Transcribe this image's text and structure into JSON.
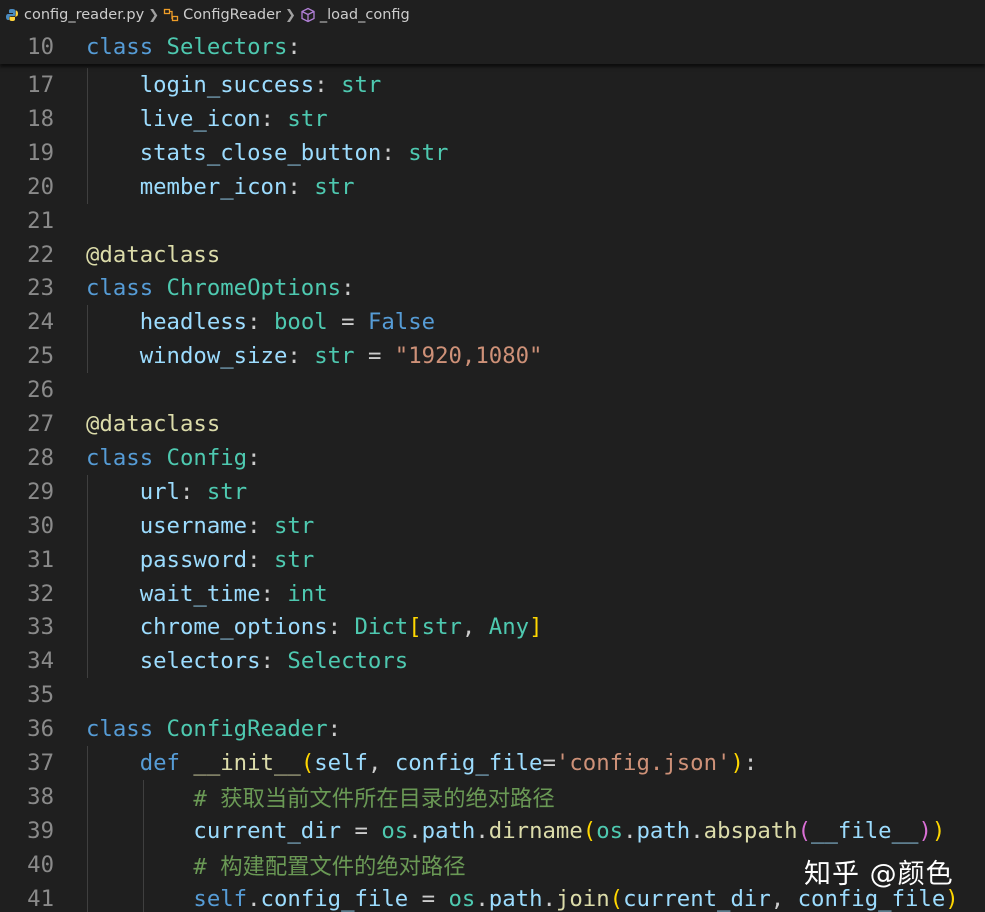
{
  "breadcrumb": {
    "file": "config_reader.py",
    "class": "ConfigReader",
    "method": "_load_config"
  },
  "editor": {
    "lines": [
      {
        "n": "10",
        "t": [
          [
            "kw",
            "class "
          ],
          [
            "cls",
            "Selectors"
          ],
          [
            "plain",
            ":"
          ]
        ]
      },
      {
        "n": "17",
        "t": [
          [
            "plain",
            "    "
          ],
          [
            "prop",
            "login_success"
          ],
          [
            "plain",
            ": "
          ],
          [
            "cls",
            "str"
          ]
        ]
      },
      {
        "n": "18",
        "t": [
          [
            "plain",
            "    "
          ],
          [
            "prop",
            "live_icon"
          ],
          [
            "plain",
            ": "
          ],
          [
            "cls",
            "str"
          ]
        ]
      },
      {
        "n": "19",
        "t": [
          [
            "plain",
            "    "
          ],
          [
            "prop",
            "stats_close_button"
          ],
          [
            "plain",
            ": "
          ],
          [
            "cls",
            "str"
          ]
        ]
      },
      {
        "n": "20",
        "t": [
          [
            "plain",
            "    "
          ],
          [
            "prop",
            "member_icon"
          ],
          [
            "plain",
            ": "
          ],
          [
            "cls",
            "str"
          ]
        ]
      },
      {
        "n": "21",
        "t": []
      },
      {
        "n": "22",
        "t": [
          [
            "fn",
            "@dataclass"
          ]
        ]
      },
      {
        "n": "23",
        "t": [
          [
            "kw",
            "class "
          ],
          [
            "cls",
            "ChromeOptions"
          ],
          [
            "plain",
            ":"
          ]
        ]
      },
      {
        "n": "24",
        "t": [
          [
            "plain",
            "    "
          ],
          [
            "prop",
            "headless"
          ],
          [
            "plain",
            ": "
          ],
          [
            "cls",
            "bool"
          ],
          [
            "plain",
            " = "
          ],
          [
            "kw",
            "False"
          ]
        ]
      },
      {
        "n": "25",
        "t": [
          [
            "plain",
            "    "
          ],
          [
            "prop",
            "window_size"
          ],
          [
            "plain",
            ": "
          ],
          [
            "cls",
            "str"
          ],
          [
            "plain",
            " = "
          ],
          [
            "str",
            "\"1920,1080\""
          ]
        ]
      },
      {
        "n": "26",
        "t": []
      },
      {
        "n": "27",
        "t": [
          [
            "fn",
            "@dataclass"
          ]
        ]
      },
      {
        "n": "28",
        "t": [
          [
            "kw",
            "class "
          ],
          [
            "cls",
            "Config"
          ],
          [
            "plain",
            ":"
          ]
        ]
      },
      {
        "n": "29",
        "t": [
          [
            "plain",
            "    "
          ],
          [
            "prop",
            "url"
          ],
          [
            "plain",
            ": "
          ],
          [
            "cls",
            "str"
          ]
        ]
      },
      {
        "n": "30",
        "t": [
          [
            "plain",
            "    "
          ],
          [
            "prop",
            "username"
          ],
          [
            "plain",
            ": "
          ],
          [
            "cls",
            "str"
          ]
        ]
      },
      {
        "n": "31",
        "t": [
          [
            "plain",
            "    "
          ],
          [
            "prop",
            "password"
          ],
          [
            "plain",
            ": "
          ],
          [
            "cls",
            "str"
          ]
        ]
      },
      {
        "n": "32",
        "t": [
          [
            "plain",
            "    "
          ],
          [
            "prop",
            "wait_time"
          ],
          [
            "plain",
            ": "
          ],
          [
            "cls",
            "int"
          ]
        ]
      },
      {
        "n": "33",
        "t": [
          [
            "plain",
            "    "
          ],
          [
            "prop",
            "chrome_options"
          ],
          [
            "plain",
            ": "
          ],
          [
            "cls",
            "Dict"
          ],
          [
            "b1",
            "["
          ],
          [
            "cls",
            "str"
          ],
          [
            "plain",
            ", "
          ],
          [
            "cls",
            "Any"
          ],
          [
            "b1",
            "]"
          ]
        ]
      },
      {
        "n": "34",
        "t": [
          [
            "plain",
            "    "
          ],
          [
            "prop",
            "selectors"
          ],
          [
            "plain",
            ": "
          ],
          [
            "cls",
            "Selectors"
          ]
        ]
      },
      {
        "n": "35",
        "t": []
      },
      {
        "n": "36",
        "t": [
          [
            "kw",
            "class "
          ],
          [
            "cls",
            "ConfigReader"
          ],
          [
            "plain",
            ":"
          ]
        ]
      },
      {
        "n": "37",
        "t": [
          [
            "plain",
            "    "
          ],
          [
            "kw",
            "def "
          ],
          [
            "fn",
            "__init__"
          ],
          [
            "b1",
            "("
          ],
          [
            "prop",
            "self"
          ],
          [
            "plain",
            ", "
          ],
          [
            "prop",
            "config_file"
          ],
          [
            "plain",
            "="
          ],
          [
            "str",
            "'config.json'"
          ],
          [
            "b1",
            ")"
          ],
          [
            "plain",
            ":"
          ]
        ]
      },
      {
        "n": "38",
        "t": [
          [
            "plain",
            "        "
          ],
          [
            "cm",
            "# 获取当前文件所在目录的绝对路径"
          ]
        ]
      },
      {
        "n": "39",
        "t": [
          [
            "plain",
            "        "
          ],
          [
            "prop",
            "current_dir"
          ],
          [
            "plain",
            " = "
          ],
          [
            "cls",
            "os"
          ],
          [
            "plain",
            "."
          ],
          [
            "prop",
            "path"
          ],
          [
            "plain",
            "."
          ],
          [
            "fn",
            "dirname"
          ],
          [
            "b1",
            "("
          ],
          [
            "cls",
            "os"
          ],
          [
            "plain",
            "."
          ],
          [
            "prop",
            "path"
          ],
          [
            "plain",
            "."
          ],
          [
            "fn",
            "abspath"
          ],
          [
            "b2",
            "("
          ],
          [
            "prop",
            "__file__"
          ],
          [
            "b2",
            ")"
          ],
          [
            "b1",
            ")"
          ]
        ]
      },
      {
        "n": "40",
        "t": [
          [
            "plain",
            "        "
          ],
          [
            "cm",
            "# 构建配置文件的绝对路径"
          ]
        ]
      },
      {
        "n": "41",
        "t": [
          [
            "plain",
            "        "
          ],
          [
            "kw",
            "self"
          ],
          [
            "plain",
            "."
          ],
          [
            "prop",
            "config_file"
          ],
          [
            "plain",
            " = "
          ],
          [
            "cls",
            "os"
          ],
          [
            "plain",
            "."
          ],
          [
            "prop",
            "path"
          ],
          [
            "plain",
            "."
          ],
          [
            "fn",
            "join"
          ],
          [
            "b1",
            "("
          ],
          [
            "prop",
            "current_dir"
          ],
          [
            "plain",
            ", "
          ],
          [
            "prop",
            "config_file"
          ],
          [
            "b1",
            ")"
          ]
        ]
      }
    ]
  },
  "watermark": "知乎 @颜色"
}
